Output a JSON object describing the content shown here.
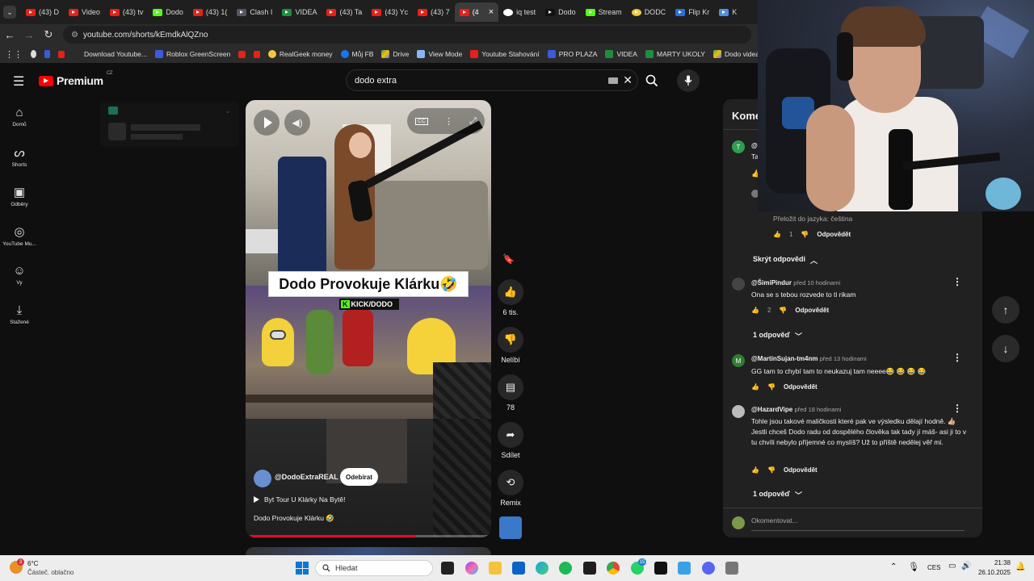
{
  "browser": {
    "tabs": [
      {
        "label": "(43) D"
      },
      {
        "label": "Video"
      },
      {
        "label": "(43) tv"
      },
      {
        "label": "Dodo"
      },
      {
        "label": "(43) 1("
      },
      {
        "label": "Clash I"
      },
      {
        "label": "VIDEA"
      },
      {
        "label": "(43) Ta"
      },
      {
        "label": "(43) Yc"
      },
      {
        "label": "(43) 7"
      },
      {
        "label": "(4"
      },
      {
        "label": "iq test"
      },
      {
        "label": "Dodo"
      },
      {
        "label": "Stream"
      },
      {
        "label": "DODC"
      },
      {
        "label": "Flip Kr"
      },
      {
        "label": "K"
      }
    ],
    "close_glyph": "×",
    "url": "youtube.com/shorts/kEmdkAlQZno",
    "bookmarks": [
      {
        "label": "Download Youtube..."
      },
      {
        "label": "Roblox GreenScreen"
      },
      {
        "label": "RealGeek money"
      },
      {
        "label": "Můj FB"
      },
      {
        "label": "Drive"
      },
      {
        "label": "View Mode"
      },
      {
        "label": "Youtube Stahování"
      },
      {
        "label": "PRO PLAZA"
      },
      {
        "label": "VIDEA"
      },
      {
        "label": "MARTY UKOLY"
      },
      {
        "label": "Dodo videa"
      }
    ]
  },
  "yt": {
    "logo_text": "Premium",
    "logo_region": "CZ",
    "search_value": "dodo extra",
    "rail": [
      {
        "label": "Domů"
      },
      {
        "label": "Shorts"
      },
      {
        "label": "Odběry"
      },
      {
        "label": "YouTube Mu..."
      },
      {
        "label": "Vy"
      },
      {
        "label": "Stažené"
      }
    ]
  },
  "short": {
    "overlay_title": "Dodo Provokuje Klárku🤣",
    "kick_tag": "KICK/DODO",
    "channel": "@DodoExtraREAL",
    "subscribe_label": "Odebírat",
    "playlist_label": "Byt Tour U Klárky Na Bytě!",
    "caption": "Dodo Provokuje Klárku 🤣",
    "progress": 0.7,
    "actions": {
      "like_count": "6 tis.",
      "dislike_label": "Nelíbí",
      "comments_count": "78",
      "share_label": "Sdílet",
      "remix_label": "Remix"
    }
  },
  "comments": {
    "title": "Kome",
    "items": [
      {
        "translate": "Přeložit do jazyka: čeština",
        "likes": "1",
        "reply": "Odpovědět",
        "toggle": "Skrýt odpovědi"
      },
      {
        "author": "@ŠimiPindur",
        "time": "před 10 hodinami",
        "text": "Ona se s tebou rozvede to ti rikam",
        "likes": "2",
        "reply": "Odpovědět",
        "replies": "1 odpověď"
      },
      {
        "author": "@MartinSujan-tm4nm",
        "time": "před 13 hodinami",
        "text": "GG tam to chybí tam to neukazuj tam neeee😂 😂 😂 😂",
        "reply": "Odpovědět",
        "avatar_letter": "M"
      },
      {
        "author": "@HazardVipe",
        "time": "před 18 hodinami",
        "text": "Tohle jsou takové maličkosti které pak ve výsledku dělají hodně. 👍🏼 Jestli chceš Dodo radu od dospělého člověka tak tady jí máš- asi ji to v tu chvíli nebylo příjemné co myslíš? Už to příště nedělej věř mi.",
        "reply": "Odpovědět",
        "replies": "1 odpověď"
      }
    ],
    "first_avatar_letter": "T",
    "first_author_partial": "@",
    "first_text_partial": "Ta",
    "input_placeholder": "Okomentovat..."
  },
  "taskbar": {
    "weather_temp": "6°C",
    "weather_desc": "Částeč. oblačno",
    "weather_badge": "3",
    "search_label": "Hledat",
    "lang": "CES",
    "time": "21:38",
    "date": "26.10.2025",
    "whatsapp_badge": "15"
  }
}
